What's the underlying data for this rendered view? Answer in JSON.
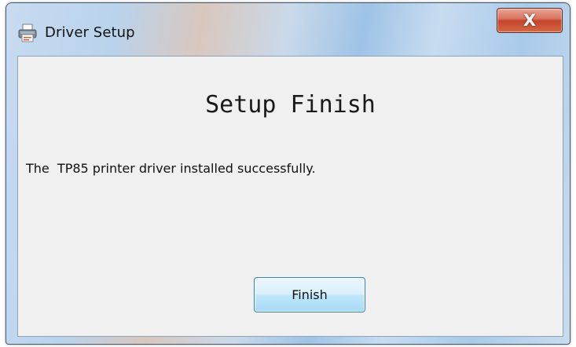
{
  "window": {
    "title": "Driver Setup",
    "icon": "printer-icon",
    "close_glyph": "X"
  },
  "content": {
    "heading": "Setup Finish",
    "message": "The  TP85 printer driver installed successfully."
  },
  "buttons": {
    "finish_label": "Finish"
  },
  "colors": {
    "close_button": "#c5442c",
    "finish_button": "#bee6fd",
    "content_background": "#f0f0f0"
  }
}
